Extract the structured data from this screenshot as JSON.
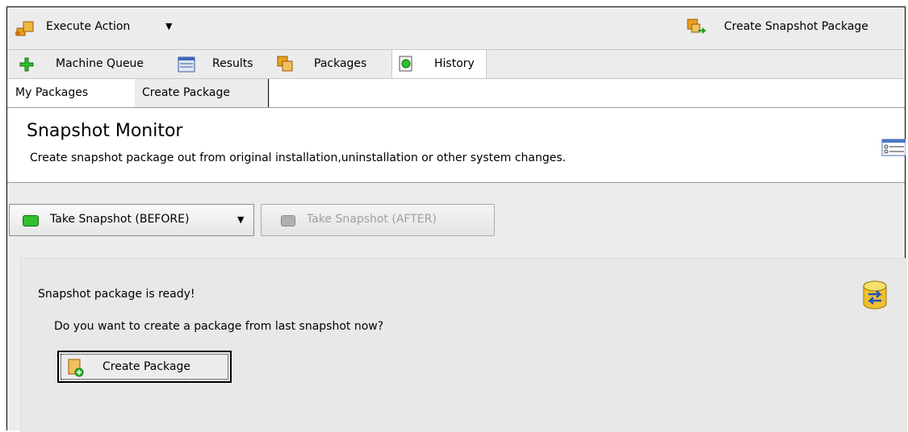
{
  "toolbar": {
    "execute_action_label": "Execute Action",
    "create_snapshot_package_label": "Create Snapshot Package"
  },
  "main_tabs": [
    {
      "label": "Machine Queue",
      "icon": "plus-icon"
    },
    {
      "label": "Results",
      "icon": "results-icon"
    },
    {
      "label": "Packages",
      "icon": "packages-icon"
    },
    {
      "label": "History",
      "icon": "history-icon"
    }
  ],
  "sub_tabs": [
    {
      "label": "My Packages"
    },
    {
      "label": "Create Package"
    }
  ],
  "header": {
    "title": "Snapshot Monitor",
    "subtitle": "Create snapshot package out from original installation,uninstallation or other system changes."
  },
  "snapshot_buttons": {
    "before_label": "Take Snapshot (BEFORE)",
    "after_label": "Take Snapshot (AFTER)"
  },
  "panel": {
    "ready_text": "Snapshot package is ready!",
    "question_text": "Do you want to create a package from last snapshot now?",
    "create_button_label": "Create Package"
  },
  "colors": {
    "accent_green": "#2fbf2f",
    "disabled_gray": "#a0a0a0",
    "icon_orange": "#e8a020"
  }
}
